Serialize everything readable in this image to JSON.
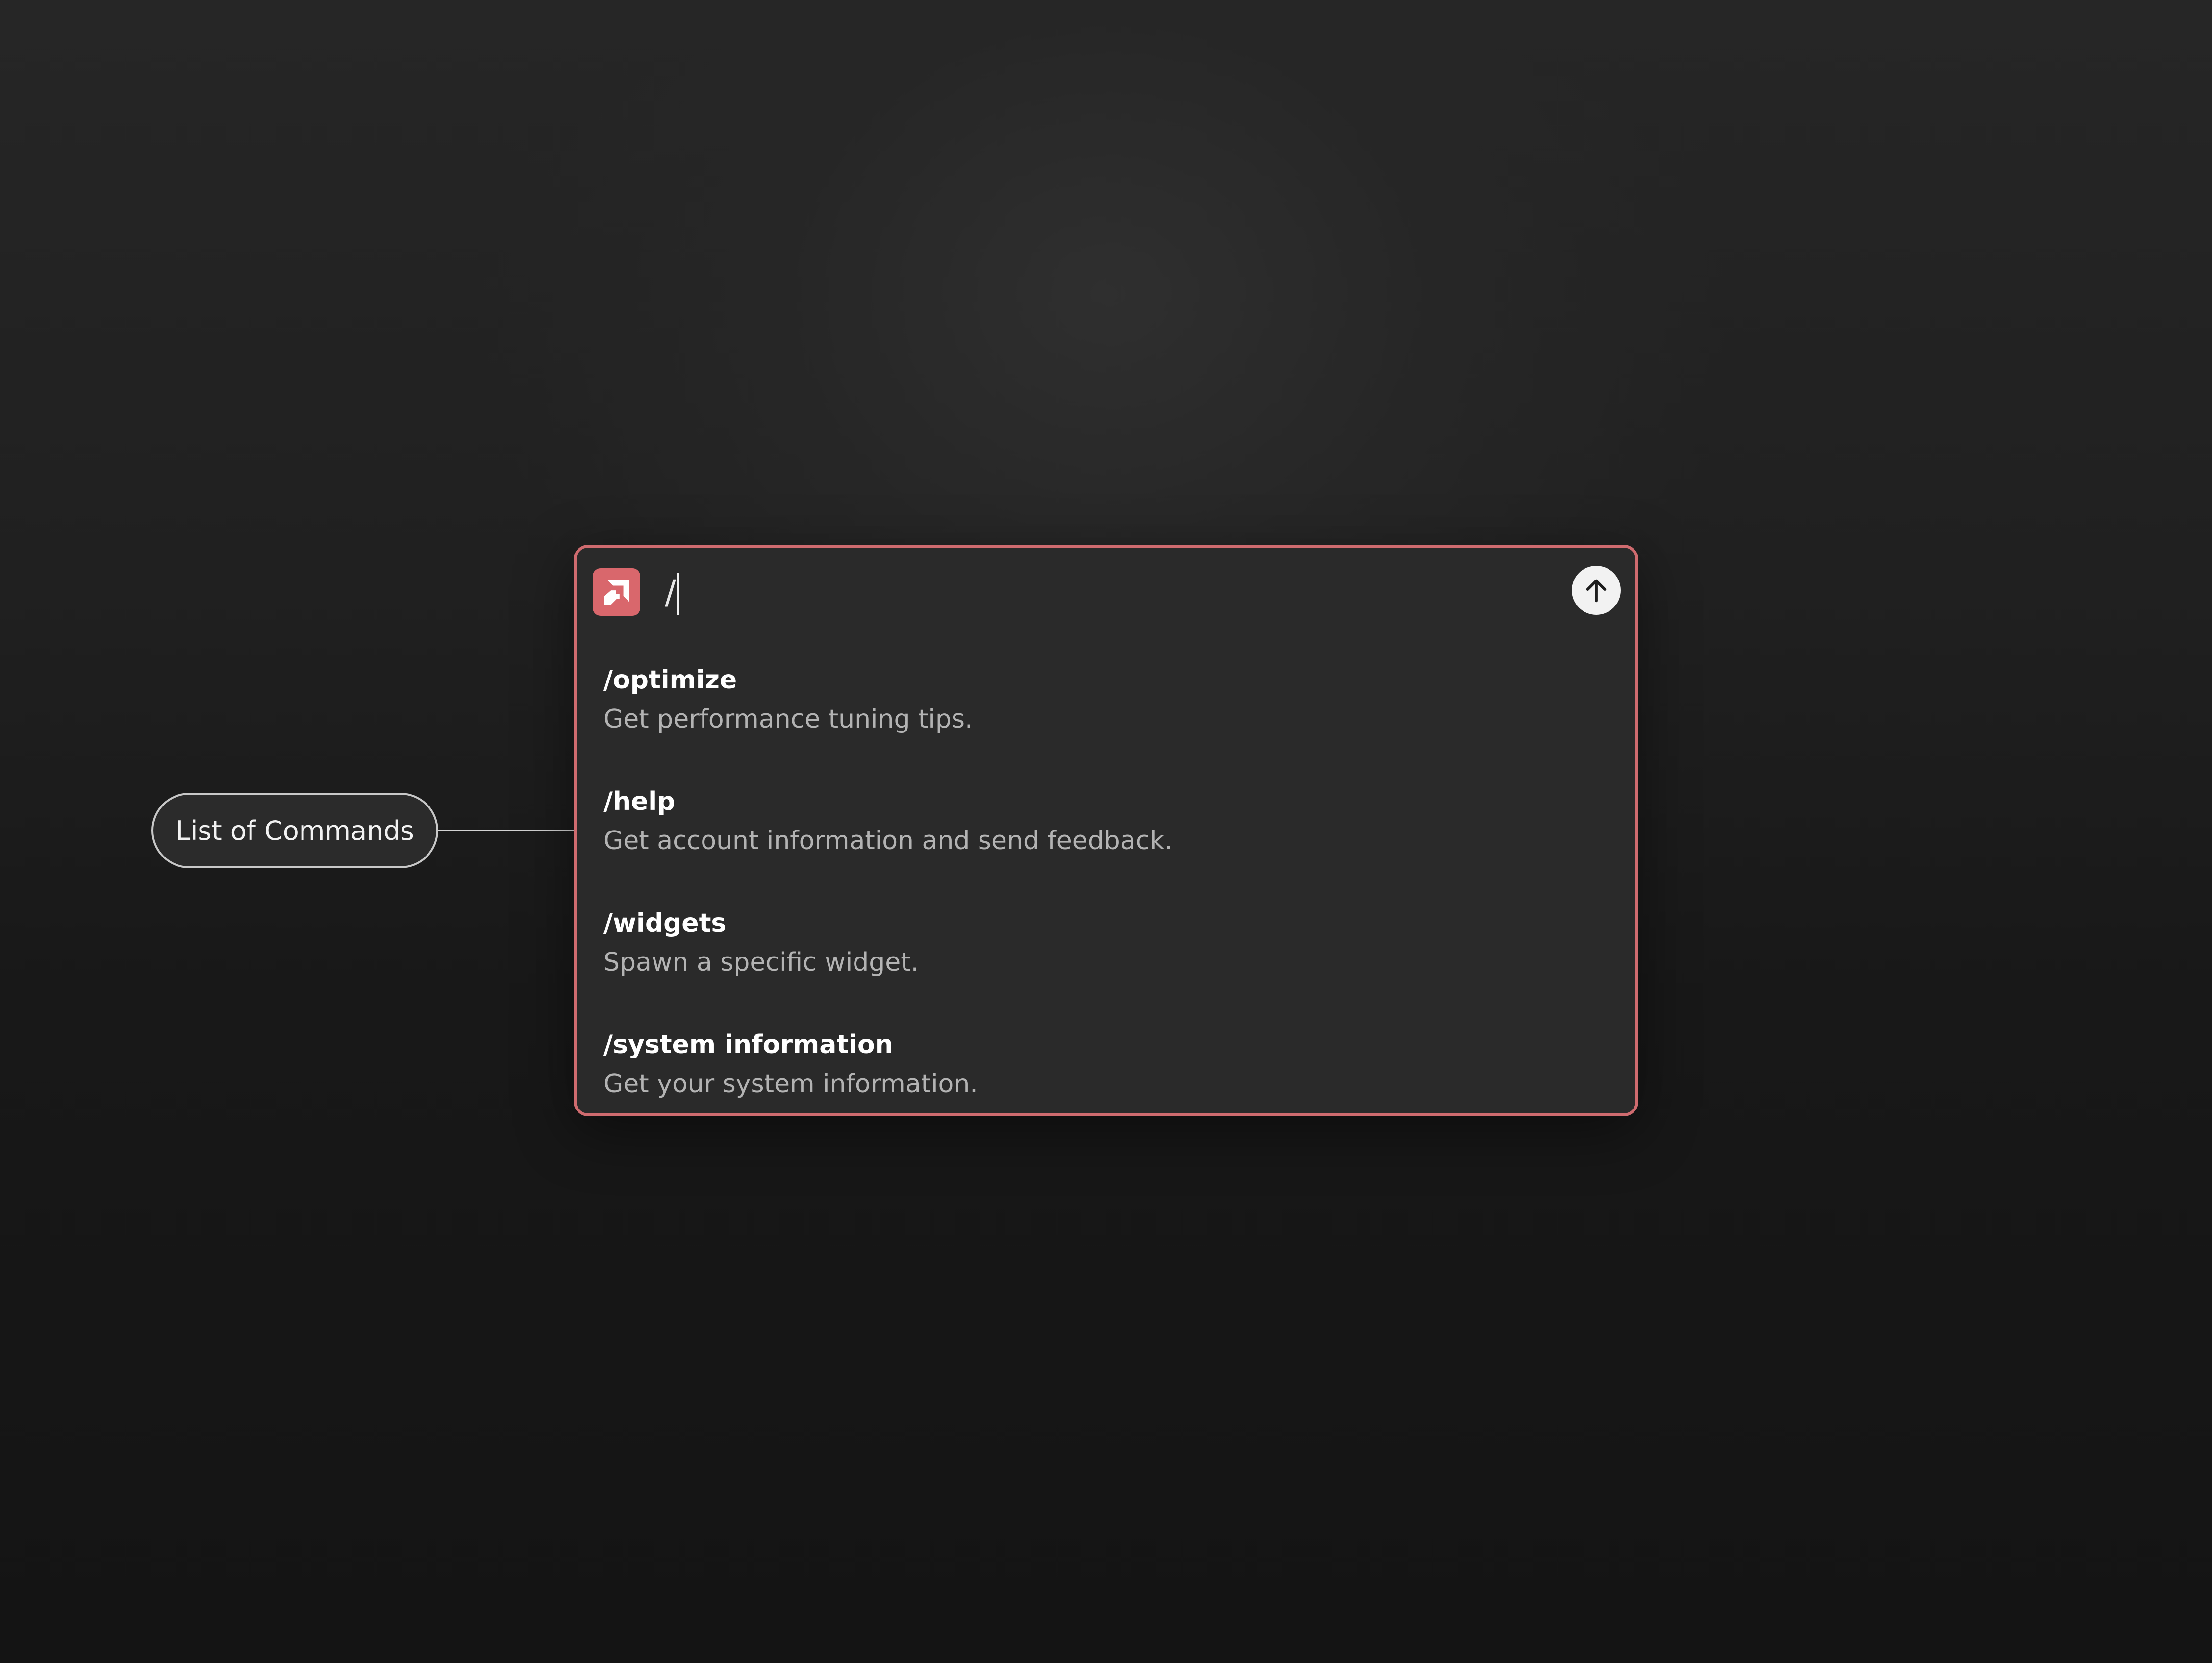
{
  "colors": {
    "accent": "#cf6b6f",
    "panel_background": "#2a2a2a",
    "page_background": "#1c1c1c"
  },
  "app": {
    "logo_icon": "amd-logo-icon"
  },
  "input": {
    "value": "/"
  },
  "send": {
    "icon": "arrow-up-icon"
  },
  "commands": [
    {
      "name": "/optimize",
      "description": "Get performance tuning tips."
    },
    {
      "name": "/help",
      "description": "Get account information and send feedback."
    },
    {
      "name": "/widgets",
      "description": "Spawn a specific widget."
    },
    {
      "name": "/system information",
      "description": "Get your system information."
    }
  ],
  "annotation": {
    "label": "List of Commands"
  }
}
